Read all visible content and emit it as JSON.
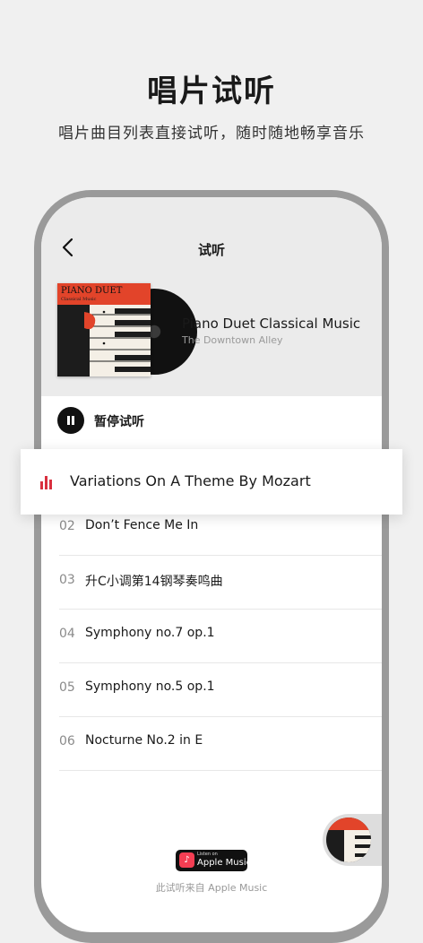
{
  "promo": {
    "title": "唱片试听",
    "subtitle": "唱片曲目列表直接试听，随时随地畅享音乐"
  },
  "nav": {
    "title": "试听",
    "back_icon": "chevron-left-icon"
  },
  "album": {
    "cover_title": "PIANO DUET",
    "cover_subtitle": "Classical Music",
    "title": "Piano Duet Classical Music",
    "artist": "The Downtown Alley"
  },
  "player": {
    "pause_label": "暂停试听",
    "pause_icon": "pause-icon"
  },
  "now_playing": {
    "title": "Variations On A Theme By Mozart",
    "icon": "equalizer-icon",
    "accent": "#d9303f"
  },
  "tracks": [
    {
      "num": "02",
      "name": "Don’t Fence Me In"
    },
    {
      "num": "03",
      "name": "升C小调第14钢琴奏鸣曲"
    },
    {
      "num": "04",
      "name": "Symphony no.7 op.1"
    },
    {
      "num": "05",
      "name": "Symphony no.5 op.1"
    },
    {
      "num": "06",
      "name": "Nocturne No.2 in E"
    }
  ],
  "footer": {
    "badge_small": "Listen on",
    "badge_big": "Apple Music",
    "source_text": "此试听来自 Apple Music"
  },
  "colors": {
    "cover_accent": "#e2442a",
    "badge_icon": "#f43e53"
  }
}
